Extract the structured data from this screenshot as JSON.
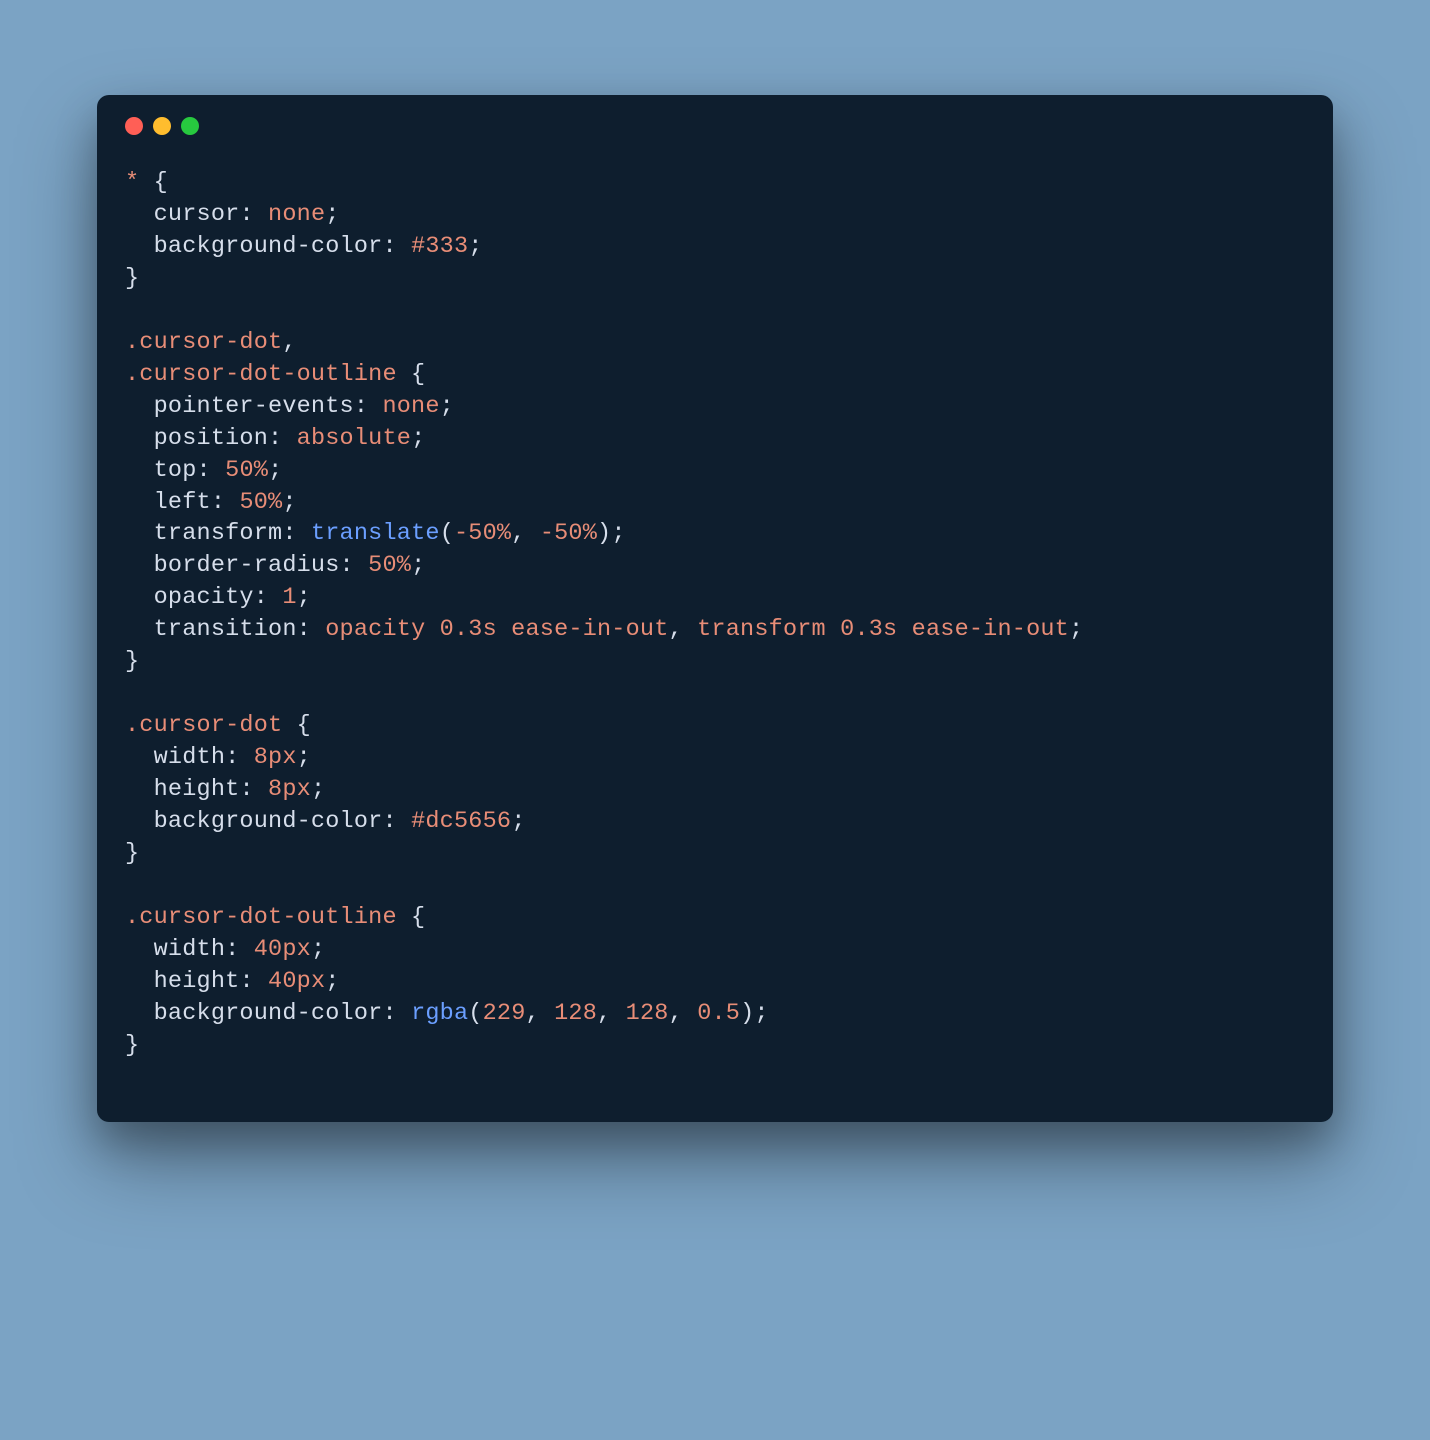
{
  "window": {
    "dots": [
      "red",
      "yellow",
      "green"
    ]
  },
  "code": {
    "lines": [
      [
        {
          "cls": "tk-selector",
          "t": "*"
        },
        {
          "cls": "tk-punct",
          "t": " {"
        }
      ],
      [
        {
          "cls": "tk-punct",
          "t": "  "
        },
        {
          "cls": "tk-prop",
          "t": "cursor"
        },
        {
          "cls": "tk-punct",
          "t": ": "
        },
        {
          "cls": "tk-value",
          "t": "none"
        },
        {
          "cls": "tk-punct",
          "t": ";"
        }
      ],
      [
        {
          "cls": "tk-punct",
          "t": "  "
        },
        {
          "cls": "tk-prop",
          "t": "background-color"
        },
        {
          "cls": "tk-punct",
          "t": ": "
        },
        {
          "cls": "tk-value",
          "t": "#333"
        },
        {
          "cls": "tk-punct",
          "t": ";"
        }
      ],
      [
        {
          "cls": "tk-punct",
          "t": "}"
        }
      ],
      [
        {
          "cls": "tk-punct",
          "t": ""
        }
      ],
      [
        {
          "cls": "tk-selector",
          "t": ".cursor-dot"
        },
        {
          "cls": "tk-punct",
          "t": ","
        }
      ],
      [
        {
          "cls": "tk-selector",
          "t": ".cursor-dot-outline"
        },
        {
          "cls": "tk-punct",
          "t": " {"
        }
      ],
      [
        {
          "cls": "tk-punct",
          "t": "  "
        },
        {
          "cls": "tk-prop",
          "t": "pointer-events"
        },
        {
          "cls": "tk-punct",
          "t": ": "
        },
        {
          "cls": "tk-value",
          "t": "none"
        },
        {
          "cls": "tk-punct",
          "t": ";"
        }
      ],
      [
        {
          "cls": "tk-punct",
          "t": "  "
        },
        {
          "cls": "tk-prop",
          "t": "position"
        },
        {
          "cls": "tk-punct",
          "t": ": "
        },
        {
          "cls": "tk-value",
          "t": "absolute"
        },
        {
          "cls": "tk-punct",
          "t": ";"
        }
      ],
      [
        {
          "cls": "tk-punct",
          "t": "  "
        },
        {
          "cls": "tk-prop",
          "t": "top"
        },
        {
          "cls": "tk-punct",
          "t": ": "
        },
        {
          "cls": "tk-value",
          "t": "50%"
        },
        {
          "cls": "tk-punct",
          "t": ";"
        }
      ],
      [
        {
          "cls": "tk-punct",
          "t": "  "
        },
        {
          "cls": "tk-prop",
          "t": "left"
        },
        {
          "cls": "tk-punct",
          "t": ": "
        },
        {
          "cls": "tk-value",
          "t": "50%"
        },
        {
          "cls": "tk-punct",
          "t": ";"
        }
      ],
      [
        {
          "cls": "tk-punct",
          "t": "  "
        },
        {
          "cls": "tk-prop",
          "t": "transform"
        },
        {
          "cls": "tk-punct",
          "t": ": "
        },
        {
          "cls": "tk-func",
          "t": "translate"
        },
        {
          "cls": "tk-punct",
          "t": "("
        },
        {
          "cls": "tk-value",
          "t": "-50%"
        },
        {
          "cls": "tk-punct",
          "t": ", "
        },
        {
          "cls": "tk-value",
          "t": "-50%"
        },
        {
          "cls": "tk-punct",
          "t": ");"
        }
      ],
      [
        {
          "cls": "tk-punct",
          "t": "  "
        },
        {
          "cls": "tk-prop",
          "t": "border-radius"
        },
        {
          "cls": "tk-punct",
          "t": ": "
        },
        {
          "cls": "tk-value",
          "t": "50%"
        },
        {
          "cls": "tk-punct",
          "t": ";"
        }
      ],
      [
        {
          "cls": "tk-punct",
          "t": "  "
        },
        {
          "cls": "tk-prop",
          "t": "opacity"
        },
        {
          "cls": "tk-punct",
          "t": ": "
        },
        {
          "cls": "tk-value",
          "t": "1"
        },
        {
          "cls": "tk-punct",
          "t": ";"
        }
      ],
      [
        {
          "cls": "tk-punct",
          "t": "  "
        },
        {
          "cls": "tk-prop",
          "t": "transition"
        },
        {
          "cls": "tk-punct",
          "t": ": "
        },
        {
          "cls": "tk-value",
          "t": "opacity 0.3s ease-in-out"
        },
        {
          "cls": "tk-punct",
          "t": ", "
        },
        {
          "cls": "tk-value",
          "t": "transform 0.3s ease-in-out"
        },
        {
          "cls": "tk-punct",
          "t": ";"
        }
      ],
      [
        {
          "cls": "tk-punct",
          "t": "}"
        }
      ],
      [
        {
          "cls": "tk-punct",
          "t": ""
        }
      ],
      [
        {
          "cls": "tk-selector",
          "t": ".cursor-dot"
        },
        {
          "cls": "tk-punct",
          "t": " {"
        }
      ],
      [
        {
          "cls": "tk-punct",
          "t": "  "
        },
        {
          "cls": "tk-prop",
          "t": "width"
        },
        {
          "cls": "tk-punct",
          "t": ": "
        },
        {
          "cls": "tk-value",
          "t": "8px"
        },
        {
          "cls": "tk-punct",
          "t": ";"
        }
      ],
      [
        {
          "cls": "tk-punct",
          "t": "  "
        },
        {
          "cls": "tk-prop",
          "t": "height"
        },
        {
          "cls": "tk-punct",
          "t": ": "
        },
        {
          "cls": "tk-value",
          "t": "8px"
        },
        {
          "cls": "tk-punct",
          "t": ";"
        }
      ],
      [
        {
          "cls": "tk-punct",
          "t": "  "
        },
        {
          "cls": "tk-prop",
          "t": "background-color"
        },
        {
          "cls": "tk-punct",
          "t": ": "
        },
        {
          "cls": "tk-value",
          "t": "#dc5656"
        },
        {
          "cls": "tk-punct",
          "t": ";"
        }
      ],
      [
        {
          "cls": "tk-punct",
          "t": "}"
        }
      ],
      [
        {
          "cls": "tk-punct",
          "t": ""
        }
      ],
      [
        {
          "cls": "tk-selector",
          "t": ".cursor-dot-outline"
        },
        {
          "cls": "tk-punct",
          "t": " {"
        }
      ],
      [
        {
          "cls": "tk-punct",
          "t": "  "
        },
        {
          "cls": "tk-prop",
          "t": "width"
        },
        {
          "cls": "tk-punct",
          "t": ": "
        },
        {
          "cls": "tk-value",
          "t": "40px"
        },
        {
          "cls": "tk-punct",
          "t": ";"
        }
      ],
      [
        {
          "cls": "tk-punct",
          "t": "  "
        },
        {
          "cls": "tk-prop",
          "t": "height"
        },
        {
          "cls": "tk-punct",
          "t": ": "
        },
        {
          "cls": "tk-value",
          "t": "40px"
        },
        {
          "cls": "tk-punct",
          "t": ";"
        }
      ],
      [
        {
          "cls": "tk-punct",
          "t": "  "
        },
        {
          "cls": "tk-prop",
          "t": "background-color"
        },
        {
          "cls": "tk-punct",
          "t": ": "
        },
        {
          "cls": "tk-func",
          "t": "rgba"
        },
        {
          "cls": "tk-punct",
          "t": "("
        },
        {
          "cls": "tk-value",
          "t": "229"
        },
        {
          "cls": "tk-punct",
          "t": ", "
        },
        {
          "cls": "tk-value",
          "t": "128"
        },
        {
          "cls": "tk-punct",
          "t": ", "
        },
        {
          "cls": "tk-value",
          "t": "128"
        },
        {
          "cls": "tk-punct",
          "t": ", "
        },
        {
          "cls": "tk-value",
          "t": "0.5"
        },
        {
          "cls": "tk-punct",
          "t": ");"
        }
      ],
      [
        {
          "cls": "tk-punct",
          "t": "}"
        }
      ]
    ]
  }
}
